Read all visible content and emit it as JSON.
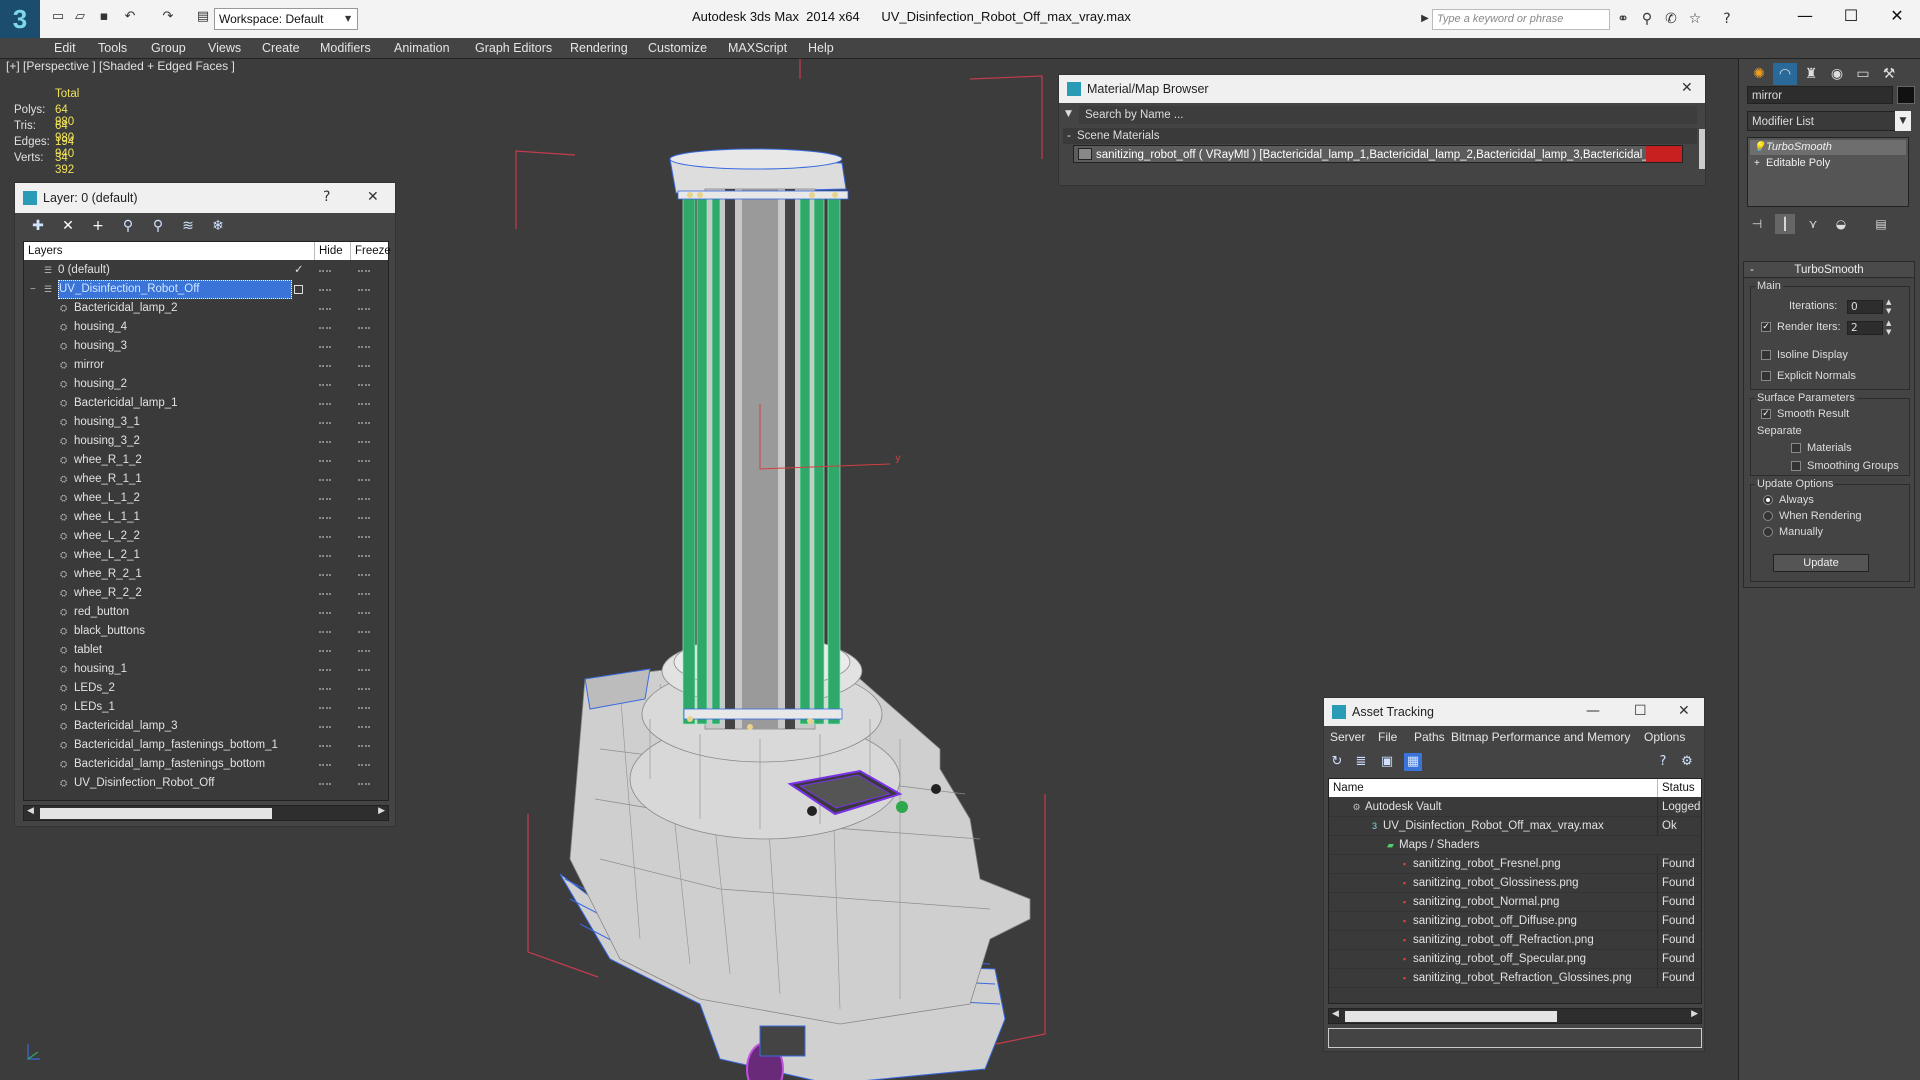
{
  "titlebar": {
    "app": "Autodesk 3ds Max  2014 x64",
    "file": "UV_Disinfection_Robot_Off_max_vray.max",
    "workspace": "Workspace: Default",
    "search_placeholder": "Type a keyword or phrase",
    "logo": "3"
  },
  "menu": [
    "Edit",
    "Tools",
    "Group",
    "Views",
    "Create",
    "Modifiers",
    "Animation",
    "Graph Editors",
    "Rendering",
    "Customize",
    "MAXScript",
    "Help"
  ],
  "viewport": {
    "label": "[+] [Perspective ] [Shaded + Edged Faces ]",
    "stats": {
      "header": "Total",
      "rows": [
        {
          "label": "Polys:",
          "value": "64 980"
        },
        {
          "label": "Tris:",
          "value": "64 980"
        },
        {
          "label": "Edges:",
          "value": "194 940"
        },
        {
          "label": "Verts:",
          "value": "34 392"
        }
      ]
    }
  },
  "layer_panel": {
    "title": "Layer: 0 (default)",
    "help": "?",
    "close": "✕",
    "col_layers": "Layers",
    "col_hide": "Hide",
    "col_freeze": "Freeze",
    "rows": [
      {
        "name": "0 (default)",
        "level": 0
      },
      {
        "name": "UV_Disinfection_Robot_Off",
        "level": 0
      },
      {
        "name": "Bactericidal_lamp_2",
        "level": 1
      },
      {
        "name": "housing_4",
        "level": 1
      },
      {
        "name": "housing_3",
        "level": 1
      },
      {
        "name": "mirror",
        "level": 1
      },
      {
        "name": "housing_2",
        "level": 1
      },
      {
        "name": "Bactericidal_lamp_1",
        "level": 1
      },
      {
        "name": "housing_3_1",
        "level": 1
      },
      {
        "name": "housing_3_2",
        "level": 1
      },
      {
        "name": "whee_R_1_2",
        "level": 1
      },
      {
        "name": "whee_R_1_1",
        "level": 1
      },
      {
        "name": "whee_L_1_2",
        "level": 1
      },
      {
        "name": "whee_L_1_1",
        "level": 1
      },
      {
        "name": "whee_L_2_2",
        "level": 1
      },
      {
        "name": "whee_L_2_1",
        "level": 1
      },
      {
        "name": "whee_R_2_1",
        "level": 1
      },
      {
        "name": "whee_R_2_2",
        "level": 1
      },
      {
        "name": "red_button",
        "level": 1
      },
      {
        "name": "black_buttons",
        "level": 1
      },
      {
        "name": "tablet",
        "level": 1
      },
      {
        "name": "housing_1",
        "level": 1
      },
      {
        "name": "LEDs_2",
        "level": 1
      },
      {
        "name": "LEDs_1",
        "level": 1
      },
      {
        "name": "Bactericidal_lamp_3",
        "level": 1
      },
      {
        "name": "Bactericidal_lamp_fastenings_bottom_1",
        "level": 1
      },
      {
        "name": "Bactericidal_lamp_fastenings_bottom",
        "level": 1
      },
      {
        "name": "UV_Disinfection_Robot_Off",
        "level": 1
      }
    ]
  },
  "material_browser": {
    "title": "Material/Map Browser",
    "close": "✕",
    "search_placeholder": "Search by Name ...",
    "section": "Scene Materials",
    "material": "sanitizing_robot_off ( VRayMtl ) [Bactericidal_lamp_1,Bactericidal_lamp_2,Bactericidal_lamp_3,Bactericidal_lam..."
  },
  "asset_tracking": {
    "title": "Asset Tracking",
    "menu": [
      "Server",
      "File",
      "Paths",
      "Bitmap Performance and Memory",
      "Options"
    ],
    "col_name": "Name",
    "col_status": "Status",
    "rows": [
      {
        "name": "Autodesk Vault",
        "status": "Logged",
        "type": "vault"
      },
      {
        "name": "UV_Disinfection_Robot_Off_max_vray.max",
        "status": "Ok",
        "type": "max"
      },
      {
        "name": "Maps / Shaders",
        "status": "",
        "type": "folder"
      },
      {
        "name": "sanitizing_robot_Fresnel.png",
        "status": "Found",
        "type": "png"
      },
      {
        "name": "sanitizing_robot_Glossiness.png",
        "status": "Found",
        "type": "png"
      },
      {
        "name": "sanitizing_robot_Normal.png",
        "status": "Found",
        "type": "png"
      },
      {
        "name": "sanitizing_robot_off_Diffuse.png",
        "status": "Found",
        "type": "png"
      },
      {
        "name": "sanitizing_robot_off_Refraction.png",
        "status": "Found",
        "type": "png"
      },
      {
        "name": "sanitizing_robot_off_Specular.png",
        "status": "Found",
        "type": "png"
      },
      {
        "name": "sanitizing_robot_Refraction_Glossines.png",
        "status": "Found",
        "type": "png"
      }
    ]
  },
  "command_panel": {
    "object_name": "mirror",
    "modifier_list": "Modifier List",
    "stack": [
      "TurboSmooth",
      "Editable Poly"
    ],
    "rollout": "TurboSmooth",
    "main_group": "Main",
    "iterations_label": "Iterations:",
    "iterations": "0",
    "render_iters_label": "Render Iters:",
    "render_iters": "2",
    "isoline": "Isoline Display",
    "explicit": "Explicit Normals",
    "surface_group": "Surface Parameters",
    "smooth_result": "Smooth Result",
    "separate": "Separate",
    "materials": "Materials",
    "smoothing_groups": "Smoothing Groups",
    "update_group": "Update Options",
    "always": "Always",
    "when_rendering": "When Rendering",
    "manually": "Manually",
    "update_btn": "Update"
  },
  "colors": {
    "accent": "#2a9bb7",
    "selection": "#3a74d8",
    "stats_value": "#f2e35a",
    "lamp_green": "#2fa86a"
  }
}
